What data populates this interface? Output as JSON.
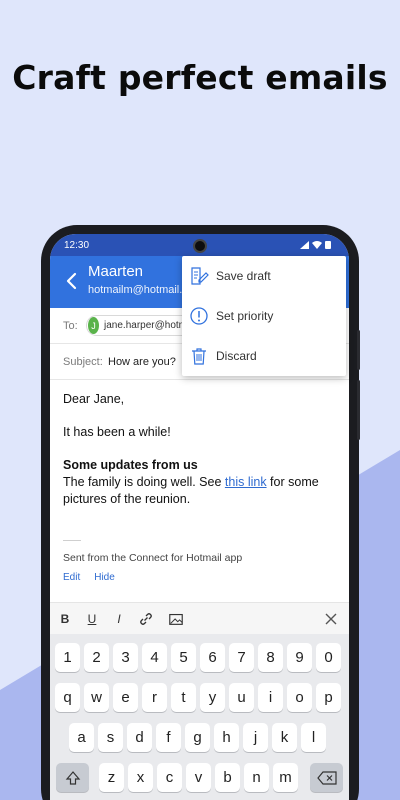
{
  "headline": "Craft perfect emails",
  "status": {
    "time": "12:30"
  },
  "header": {
    "sender_name": "Maarten",
    "sender_email": "hotmailm@hotmail.c"
  },
  "to": {
    "label": "To:",
    "recipient_initial": "J",
    "recipient": "jane.harper@hotm"
  },
  "subject": {
    "label": "Subject:",
    "value": "How are you?"
  },
  "body": {
    "greeting": "Dear Jane,",
    "line1": "It has been a while!",
    "heading": "Some updates from us",
    "para_before_link": "The family is doing well. See ",
    "link_text": "this link",
    "para_after_link": " for some pictures of the reunion."
  },
  "signature": {
    "text": "Sent from the Connect for Hotmail app",
    "edit": "Edit",
    "hide": "Hide"
  },
  "menu": {
    "items": [
      {
        "label": "Save draft",
        "icon": "save-draft-icon"
      },
      {
        "label": "Set priority",
        "icon": "priority-icon"
      },
      {
        "label": "Discard",
        "icon": "trash-icon"
      }
    ]
  },
  "toolbar": {
    "bold": "B",
    "underline": "U",
    "italic": "I"
  },
  "keyboard": {
    "row1": [
      "1",
      "2",
      "3",
      "4",
      "5",
      "6",
      "7",
      "8",
      "9",
      "0"
    ],
    "row2": [
      "q",
      "w",
      "e",
      "r",
      "t",
      "y",
      "u",
      "i",
      "o",
      "p"
    ],
    "row3": [
      "a",
      "s",
      "d",
      "f",
      "g",
      "h",
      "j",
      "k",
      "l"
    ],
    "row4": [
      "z",
      "x",
      "c",
      "v",
      "b",
      "n",
      "m"
    ]
  },
  "colors": {
    "accent": "#3172de",
    "status_bar": "#2a52b5",
    "background": "#dfe6fb",
    "wedge": "#aab7ef"
  }
}
